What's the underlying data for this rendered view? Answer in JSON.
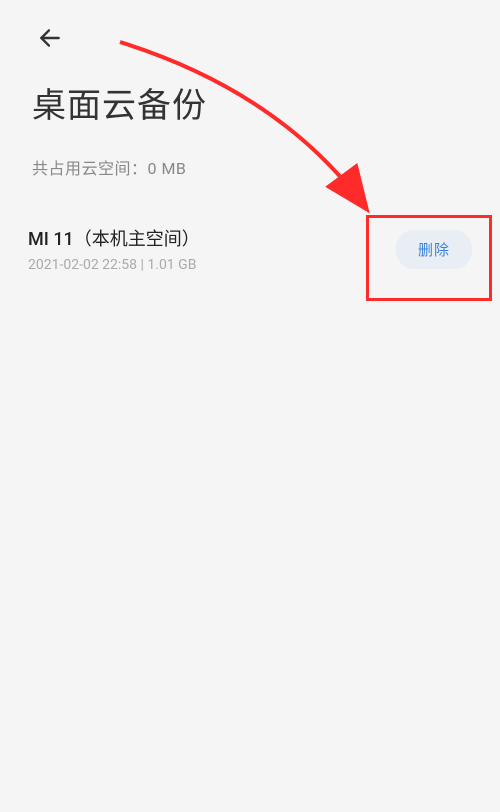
{
  "header": {
    "title": "桌面云备份"
  },
  "summary": {
    "label": "共占用云空间：0 MB"
  },
  "backups": [
    {
      "device_label": "MI 11（本机主空间）",
      "meta": "2021-02-02 22:58 | 1.01 GB",
      "delete_label": "删除"
    }
  ],
  "annotation": {
    "arrow_color": "#ff2a2a"
  }
}
